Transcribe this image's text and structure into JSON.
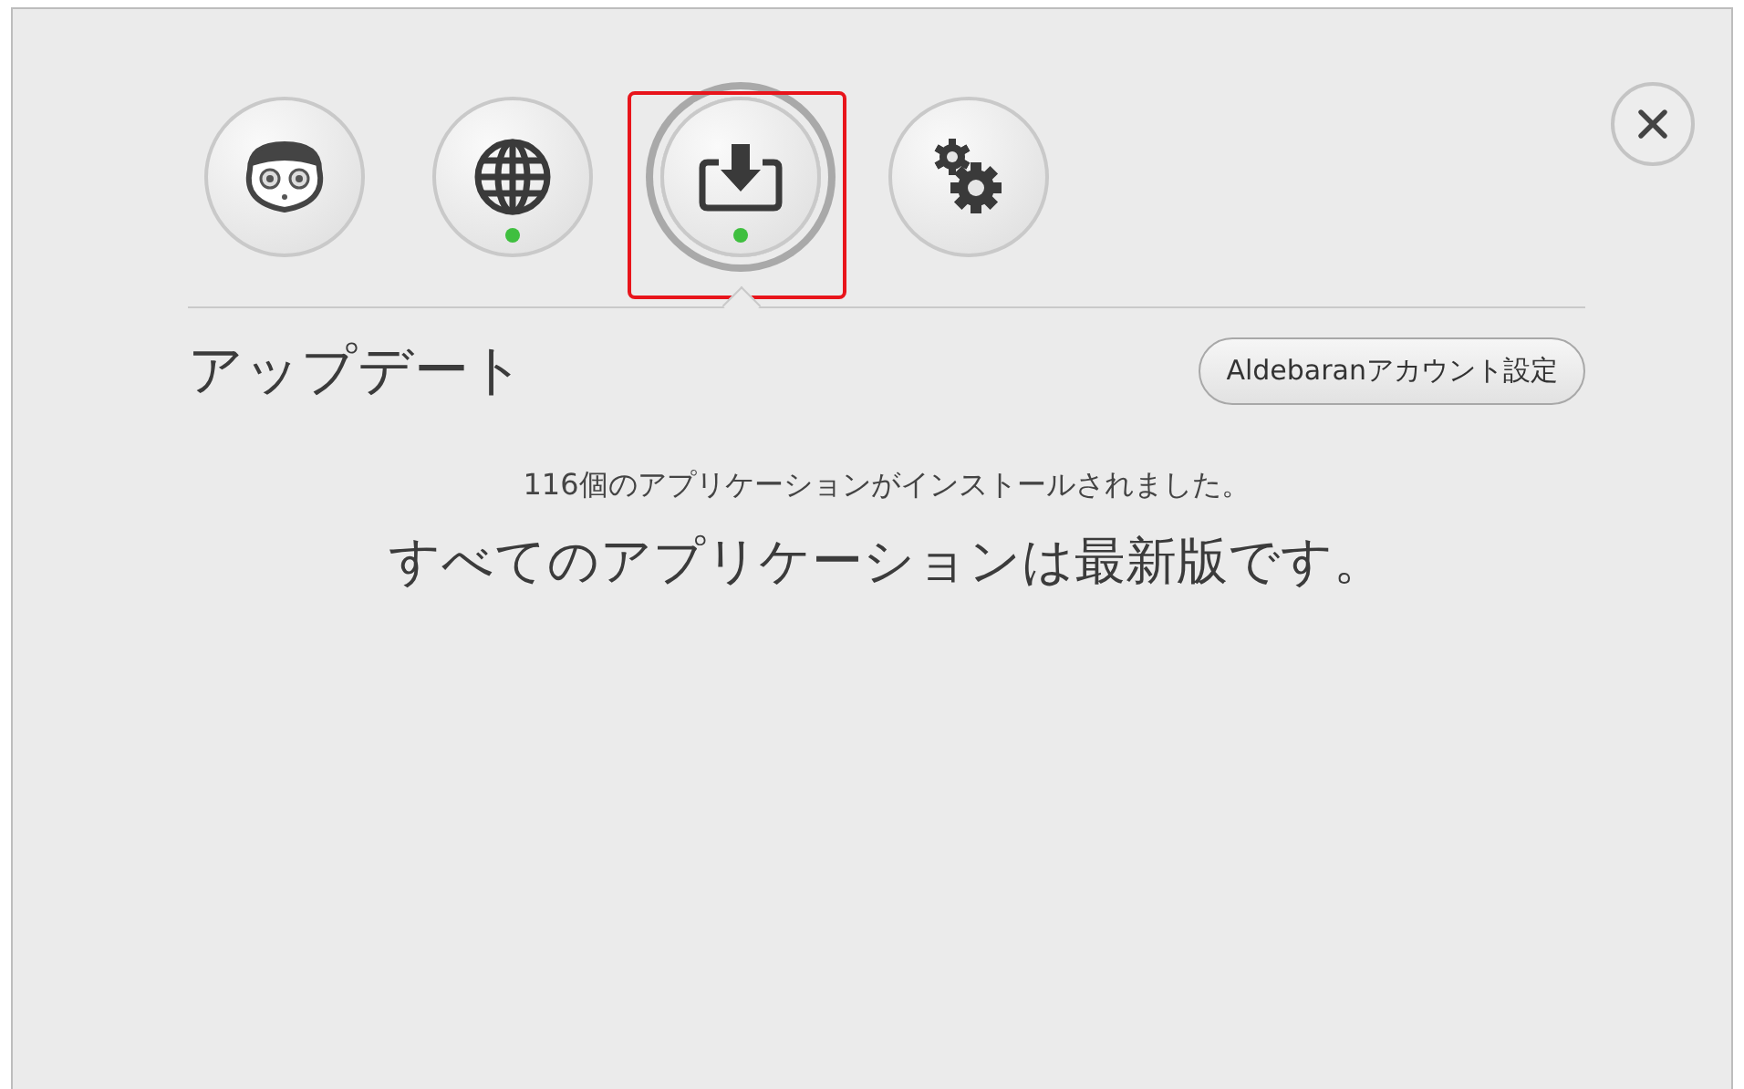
{
  "tabs": [
    {
      "kind": "robot",
      "selected": false,
      "status_dot": false,
      "highlighted": false
    },
    {
      "kind": "globe",
      "selected": false,
      "status_dot": true,
      "highlighted": false
    },
    {
      "kind": "download",
      "selected": true,
      "status_dot": true,
      "highlighted": true
    },
    {
      "kind": "gears",
      "selected": false,
      "status_dot": false,
      "highlighted": false
    }
  ],
  "title": "アップデート",
  "account_button": "Aldebaranアカウント設定",
  "installed_message": "116個のアプリケーションがインストールされました。",
  "status_message": "すべてのアプリケーションは最新版です。"
}
